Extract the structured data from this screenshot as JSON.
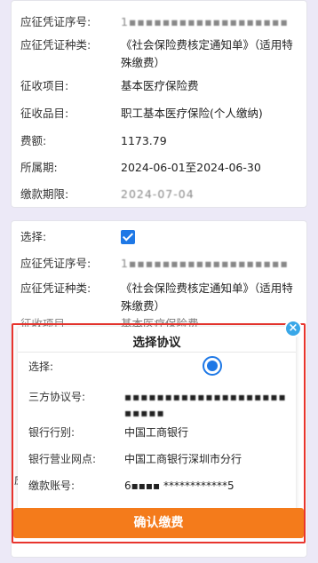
{
  "record1": {
    "seq_label": "应征凭证序号:",
    "seq_value": "1▪▪▪▪▪▪▪▪▪▪▪▪▪▪▪▪▪▪▪",
    "type_label": "应征凭证种类:",
    "type_value": "《社会保险费核定通知单》（适用特殊缴费）",
    "item_label": "征收项目:",
    "item_value": "基本医疗保险费",
    "subitem_label": "征收品目:",
    "subitem_value": "职工基本医疗保险(个人缴纳)",
    "amount_label": "费额:",
    "amount_value": "1173.79",
    "period_label": "所属期:",
    "period_value": "2024-06-01至2024-06-30",
    "deadline_label": "缴款期限:",
    "deadline_value": "2024-07-04"
  },
  "record2": {
    "select_label": "选择:",
    "seq_label": "应征凭证序号:",
    "seq_value": "1▪▪▪▪▪▪▪▪▪▪▪▪▪▪▪▪▪▪▪",
    "type_label": "应征凭证种类:",
    "type_value": "《社会保险费核定通知单》（适用特殊缴费）",
    "item_label_peek": "征收项目",
    "item_value_peek": "基本医疗保险费",
    "peek_label": "应"
  },
  "dialog": {
    "title": "选择协议",
    "select_label": "选择:",
    "agreement_label": "三方协议号:",
    "agreement_value": "▪▪▪▪▪▪▪▪▪▪▪▪▪▪▪▪▪▪▪▪▪▪▪▪▪",
    "bank_label": "银行行别:",
    "bank_value": "中国工商银行",
    "branch_label": "银行营业网点:",
    "branch_value": "中国工商银行深圳市分行",
    "account_label": "缴款账号:",
    "account_value": "6▪▪▪▪  ************5",
    "close_icon": "×"
  },
  "footer": {
    "confirm_label": "确认缴费"
  },
  "colors": {
    "accent": "#1e78e6",
    "confirm": "#f47b1b",
    "highlight": "#e8352e"
  }
}
